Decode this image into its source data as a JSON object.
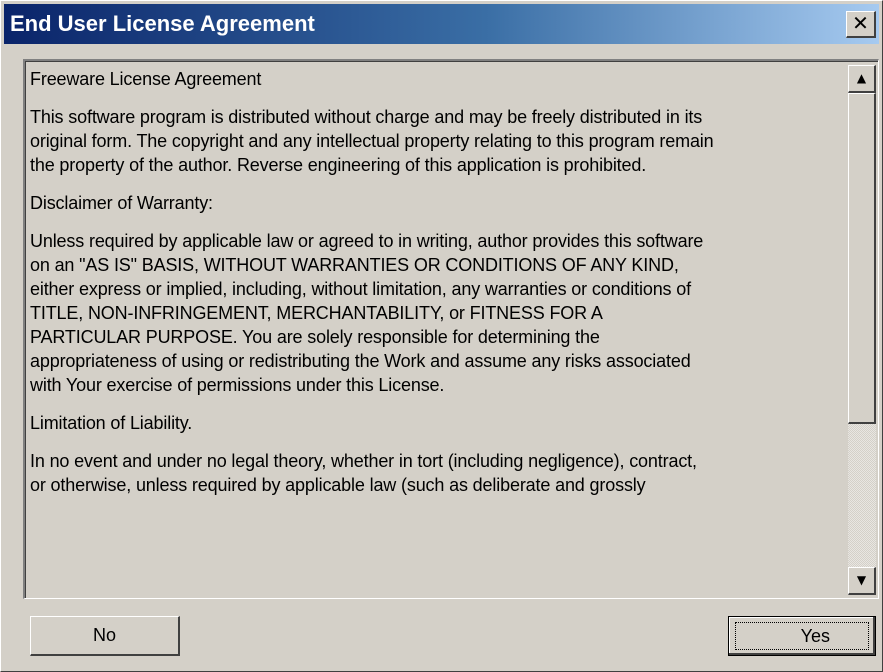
{
  "window": {
    "title": "End User License Agreement",
    "close_label": "✕"
  },
  "license": {
    "paragraphs": [
      "Freeware License Agreement",
      "This software program is distributed without charge and may be freely distributed in its\noriginal form.  The copyright and any intellectual property relating to this program remain\nthe property of the author. Reverse engineering of this application is prohibited.",
      "Disclaimer of Warranty:",
      "Unless required by applicable law or agreed to in writing, author provides this software\non an \"AS IS\" BASIS, WITHOUT WARRANTIES OR CONDITIONS OF ANY KIND,\neither express or implied, including, without limitation, any warranties or conditions of\nTITLE, NON-INFRINGEMENT, MERCHANTABILITY, or FITNESS FOR A\nPARTICULAR PURPOSE. You are solely responsible for determining the\nappropriateness of using or redistributing the Work and assume any risks associated\nwith Your exercise of permissions under this License.",
      "Limitation of Liability.",
      "In no event and under no legal theory, whether in tort (including negligence), contract,\nor otherwise, unless required by applicable law (such as deliberate and grossly"
    ]
  },
  "scrollbar": {
    "up_icon": "▲",
    "down_icon": "▼"
  },
  "buttons": {
    "no_label": "No",
    "yes_label": "Yes"
  },
  "colors": {
    "title_start": "#0a246a",
    "title_end": "#a6caf0",
    "face": "#d4d0c8"
  }
}
